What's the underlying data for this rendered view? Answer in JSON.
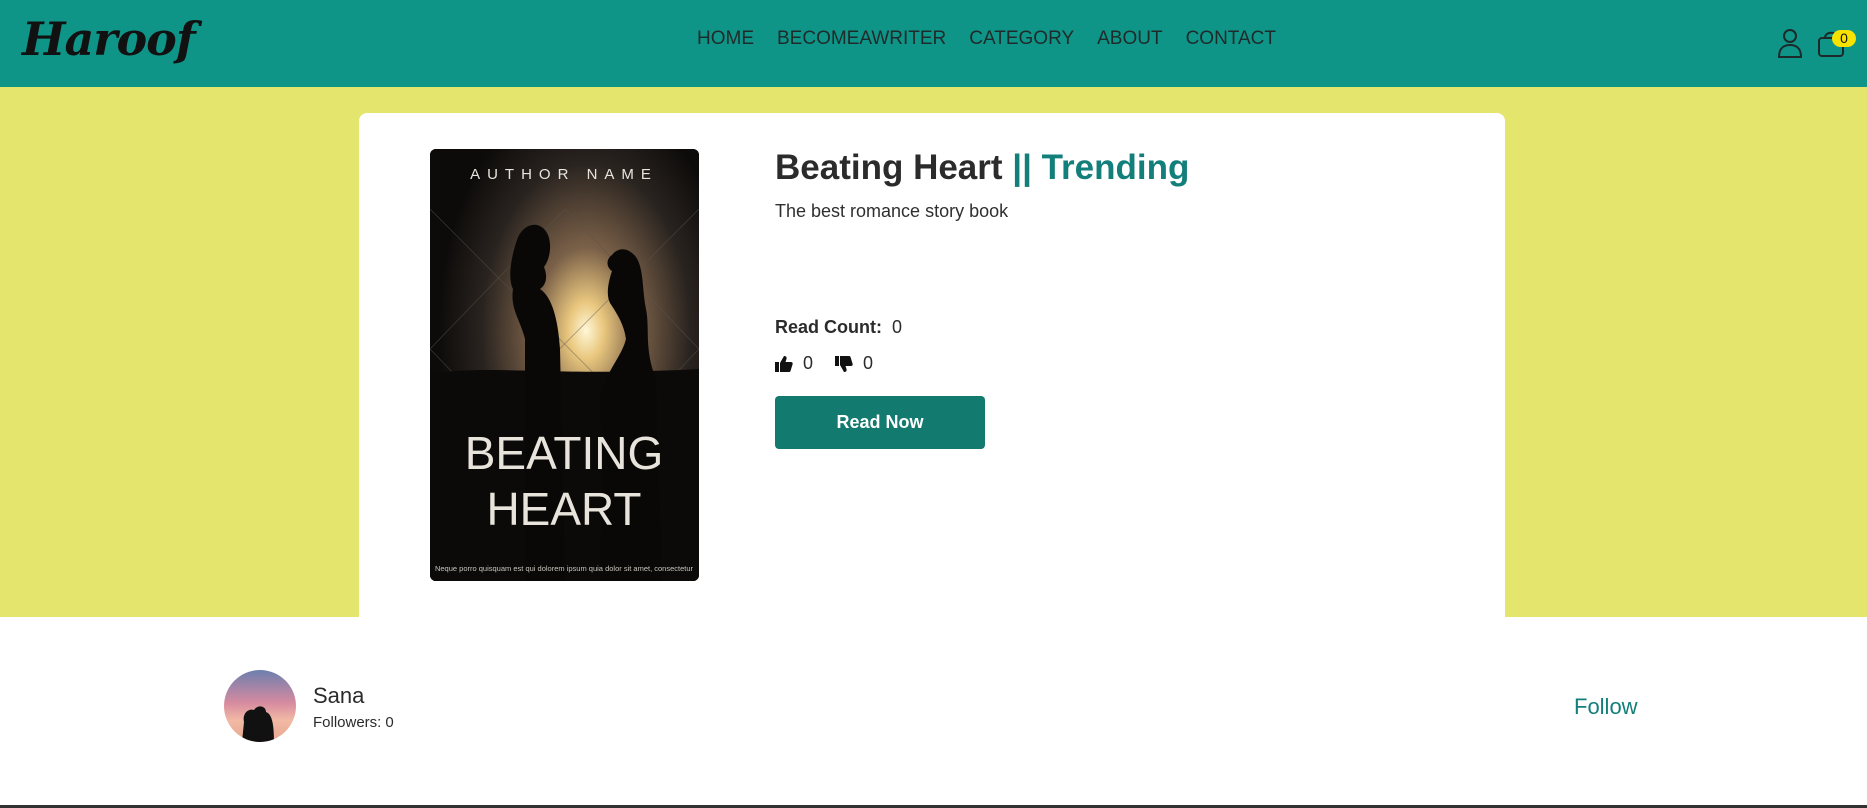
{
  "header": {
    "logo": "Haroof",
    "nav": [
      "HOME",
      "BECOMEAWRITER",
      "CATEGORY",
      "ABOUT",
      "CONTACT"
    ],
    "cart_count": "0"
  },
  "book": {
    "title": "Beating Heart",
    "tag": "|| Trending",
    "description": "The best romance story book",
    "read_count_label": "Read Count:",
    "read_count": "0",
    "likes": "0",
    "dislikes": "0",
    "read_button": "Read Now",
    "cover": {
      "author_line": "AUTHOR NAME",
      "title_line1": "BEATING",
      "title_line2": "HEART",
      "footer_text": "Neque porro quisquam est qui dolorem ipsum quia dolor sit amet, consectetur"
    }
  },
  "author": {
    "name": "Sana",
    "followers_label": "Followers:",
    "followers": "0",
    "follow_button": "Follow"
  },
  "colors": {
    "header_bg": "#0f9488",
    "hero_bg": "#e4e56d",
    "accent": "#137f7a",
    "button_bg": "#137a70",
    "badge": "#f7e200"
  }
}
